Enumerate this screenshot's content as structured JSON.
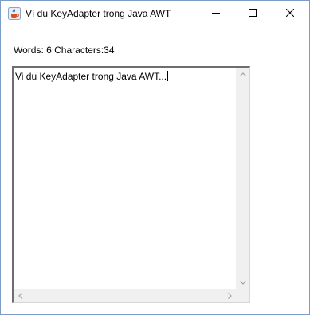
{
  "window": {
    "title": "Ví dụ KeyAdapter trong Java AWT",
    "icon": "java-coffee-cup-icon",
    "controls": {
      "minimize_icon": "minimize-icon",
      "maximize_icon": "maximize-icon",
      "close_icon": "close-icon"
    }
  },
  "status": {
    "label": "Words: 6 Characters:34"
  },
  "textarea": {
    "value": "Vi du KeyAdapter trong Java AWT..."
  },
  "colors": {
    "window_border": "#7a9cc6",
    "scrollbar_track": "#f0f0f0",
    "scroll_arrow": "#a3a3a3"
  }
}
